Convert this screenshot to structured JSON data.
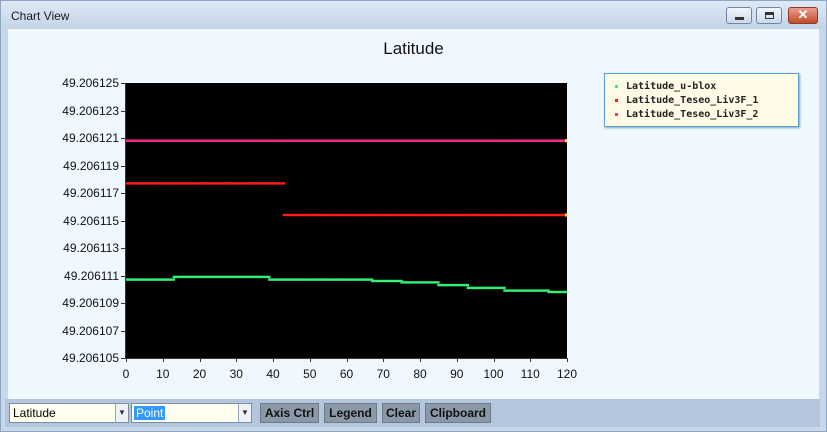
{
  "window": {
    "title": "Chart View",
    "minimize_glyph": "minimize-icon",
    "maximize_glyph": "maximize-icon",
    "close_label": "✕"
  },
  "chart_data": {
    "type": "scatter",
    "title": "Latitude",
    "xlim": [
      0,
      120
    ],
    "ylim": [
      49.206105,
      49.206125
    ],
    "x_ticks": [
      "0",
      "10",
      "20",
      "30",
      "40",
      "50",
      "60",
      "70",
      "80",
      "90",
      "100",
      "110",
      "120"
    ],
    "y_ticks": [
      "49.206125",
      "49.206123",
      "49.206121",
      "49.206119",
      "49.206117",
      "49.206115",
      "49.206113",
      "49.206111",
      "49.206109",
      "49.206107",
      "49.206105"
    ],
    "legend_position": "top-right",
    "background": "#000000",
    "series": [
      {
        "name": "Latitude_u-blox",
        "color": "#33ee77",
        "segments": [
          {
            "x0": 0,
            "x1": 13,
            "y": 49.2061107
          },
          {
            "x0": 13,
            "x1": 39,
            "y": 49.2061109
          },
          {
            "x0": 39,
            "x1": 67,
            "y": 49.2061107
          },
          {
            "x0": 67,
            "x1": 75,
            "y": 49.2061106
          },
          {
            "x0": 75,
            "x1": 85,
            "y": 49.2061105
          },
          {
            "x0": 85,
            "x1": 93,
            "y": 49.2061103
          },
          {
            "x0": 93,
            "x1": 103,
            "y": 49.2061101
          },
          {
            "x0": 103,
            "x1": 115,
            "y": 49.2061099
          },
          {
            "x0": 115,
            "x1": 120,
            "y": 49.2061098
          }
        ]
      },
      {
        "name": "Latitude_Teseo_Liv3F_1",
        "color": "#ff1a1a",
        "segments": [
          {
            "x0": 0,
            "x1": 43,
            "y": 49.2061177
          },
          {
            "x0": 43,
            "x1": 120,
            "y": 49.2061154
          }
        ]
      },
      {
        "name": "Latitude_Teseo_Liv3F_2",
        "color": "#ff2a88",
        "segments": [
          {
            "x0": 0,
            "x1": 120,
            "y": 49.2061208
          }
        ]
      }
    ]
  },
  "toolbar": {
    "series_select": "Latitude",
    "style_select": "Point",
    "axis_ctrl": "Axis Ctrl",
    "legend": "Legend",
    "clear": "Clear",
    "clipboard": "Clipboard"
  }
}
